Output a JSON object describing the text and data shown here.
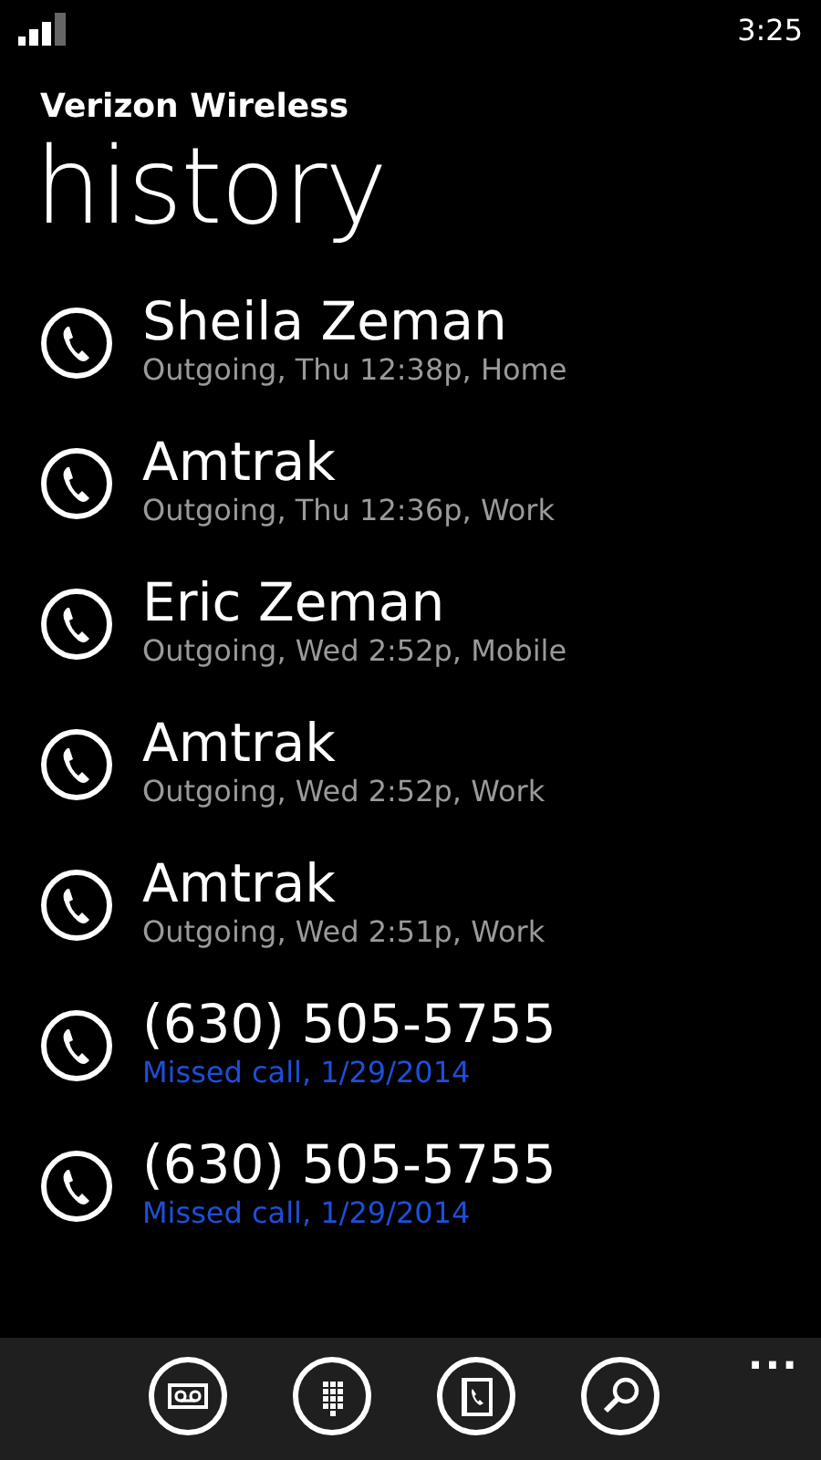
{
  "status_bar": {
    "time": "3:25"
  },
  "carrier": "Verizon Wireless",
  "title": "history",
  "calls": [
    {
      "name": "Sheila Zeman",
      "detail": "Outgoing, Thu 12:38p, Home",
      "missed": false
    },
    {
      "name": "Amtrak",
      "detail": "Outgoing, Thu 12:36p, Work",
      "missed": false
    },
    {
      "name": "Eric Zeman",
      "detail": "Outgoing, Wed 2:52p, Mobile",
      "missed": false
    },
    {
      "name": "Amtrak",
      "detail": "Outgoing, Wed 2:52p, Work",
      "missed": false
    },
    {
      "name": "Amtrak",
      "detail": "Outgoing, Wed 2:51p, Work",
      "missed": false
    },
    {
      "name": "(630) 505-5755",
      "detail": "Missed call, 1/29/2014",
      "missed": true
    },
    {
      "name": "(630) 505-5755",
      "detail": "Missed call, 1/29/2014",
      "missed": true
    }
  ],
  "app_bar": {
    "buttons": [
      {
        "kind": "voicemail"
      },
      {
        "kind": "keypad"
      },
      {
        "kind": "contacts"
      },
      {
        "kind": "search"
      }
    ],
    "more": "..."
  }
}
